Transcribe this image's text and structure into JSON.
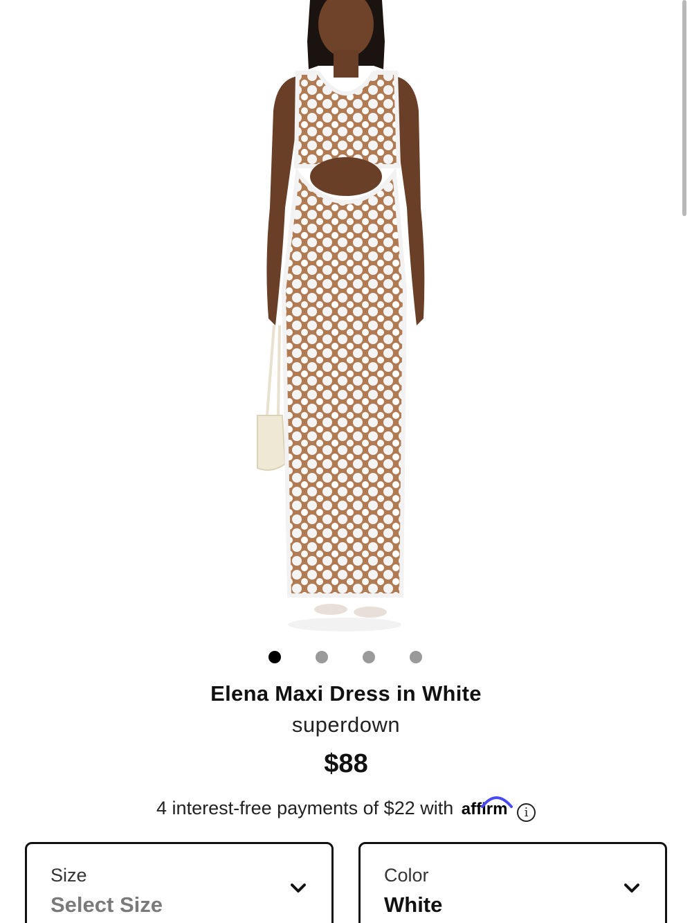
{
  "product": {
    "image_alt": "Model wearing white crochet maxi dress with cutout",
    "title": "Elena Maxi Dress in White",
    "brand": "superdown",
    "price": "$88"
  },
  "carousel": {
    "total_images": 4,
    "active_index": 0
  },
  "payments": {
    "text": "4 interest-free payments of $22 with",
    "provider": "affirm",
    "info_icon": "info-icon"
  },
  "selectors": {
    "size": {
      "label": "Size",
      "value": "Select Size",
      "icon": "chevron-down-icon"
    },
    "color": {
      "label": "Color",
      "value": "White",
      "icon": "chevron-down-icon"
    }
  },
  "colors": {
    "accent_affirm": "#4a4af4",
    "text": "#111111",
    "placeholder": "#7a7a7a",
    "dot_inactive": "#9a9a9a"
  }
}
